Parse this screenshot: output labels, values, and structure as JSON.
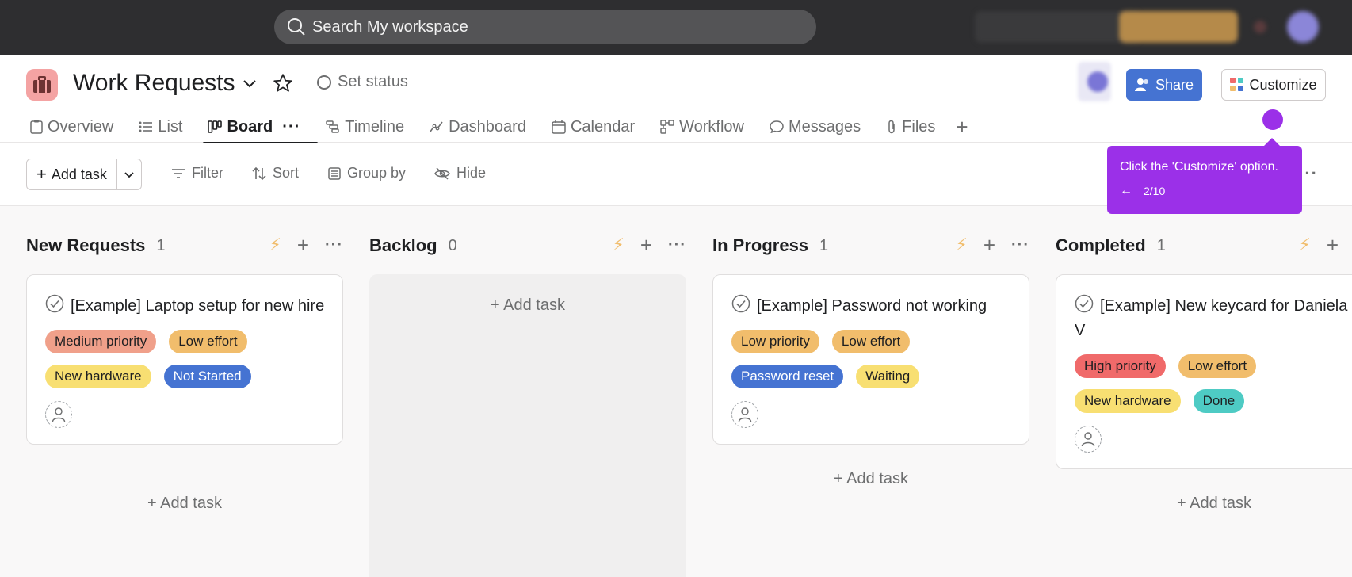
{
  "search": {
    "placeholder": "Search My workspace"
  },
  "project": {
    "title": "Work Requests",
    "set_status": "Set status"
  },
  "header": {
    "share": "Share",
    "customize": "Customize"
  },
  "tabs": [
    {
      "label": "Overview"
    },
    {
      "label": "List"
    },
    {
      "label": "Board",
      "active": true
    },
    {
      "label": "Timeline"
    },
    {
      "label": "Dashboard"
    },
    {
      "label": "Calendar"
    },
    {
      "label": "Workflow"
    },
    {
      "label": "Messages"
    },
    {
      "label": "Files"
    }
  ],
  "toolbar": {
    "add_task": "Add task",
    "filter": "Filter",
    "sort": "Sort",
    "group_by": "Group by",
    "hide": "Hide"
  },
  "columns": [
    {
      "title": "New Requests",
      "count": "1",
      "add_task": "Add task",
      "card": {
        "title": "[Example] Laptop setup for new hire",
        "tags": [
          "Medium priority",
          "Low effort",
          "New hardware",
          "Not Started"
        ]
      }
    },
    {
      "title": "Backlog",
      "count": "0",
      "add_task": "Add task"
    },
    {
      "title": "In Progress",
      "count": "1",
      "add_task": "Add task",
      "card": {
        "title": "[Example] Password not working",
        "tags": [
          "Low priority",
          "Low effort",
          "Password reset",
          "Waiting"
        ]
      }
    },
    {
      "title": "Completed",
      "count": "1",
      "add_task": "Add task",
      "card": {
        "title": "[Example] New keycard for Daniela V",
        "tags": [
          "High priority",
          "Low effort",
          "New hardware",
          "Done"
        ]
      }
    }
  ],
  "tooltip": {
    "text": "Click the 'Customize' option.",
    "step": "2/10"
  },
  "colors": {
    "accent": "#4573d2",
    "tooltip": "#9b30e8",
    "topbar": "#2e2e30"
  }
}
